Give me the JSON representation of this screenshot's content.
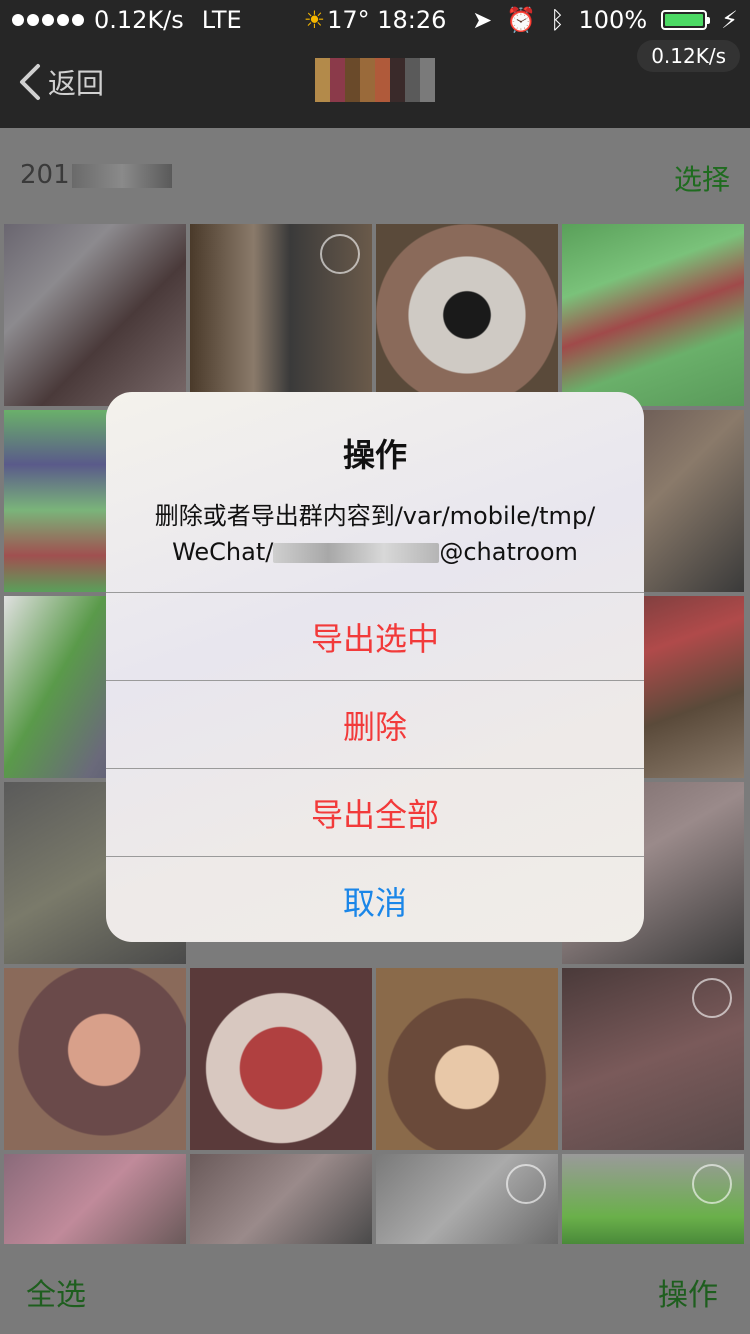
{
  "status_bar": {
    "speed": "0.12K/s",
    "network": "LTE",
    "weather": "17°",
    "time": "18:26",
    "battery": "100%",
    "speed_pill": "0.12K/s"
  },
  "nav": {
    "back_label": "返回"
  },
  "section": {
    "date_prefix": "201",
    "select_label": "选择"
  },
  "toolbar": {
    "select_all_label": "全选",
    "action_label": "操作"
  },
  "alert": {
    "title": "操作",
    "message_line1": "删除或者导出群内容到/var/mobile/tmp/",
    "message_line2_prefix": "WeChat/",
    "message_line2_suffix": "@chatroom",
    "buttons": {
      "export_selected": "导出选中",
      "delete": "删除",
      "export_all": "导出全部",
      "cancel": "取消"
    }
  },
  "colors": {
    "destructive": "#f23a3a",
    "cancel": "#1a86e8",
    "accent_green": "#1e5e1e",
    "battery": "#4cd964"
  }
}
